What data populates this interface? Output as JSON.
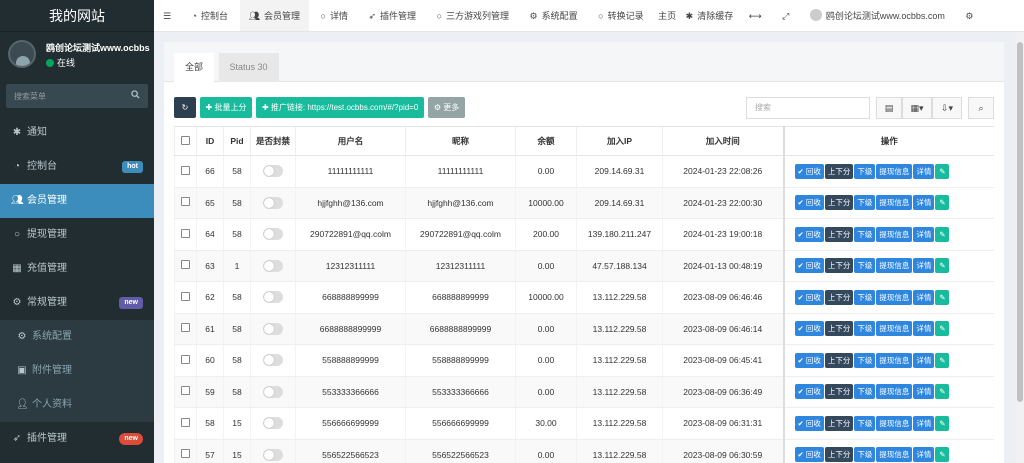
{
  "sidebar": {
    "brand": "我的网站",
    "user": {
      "name": "鸥创论坛测试www.ocbbs",
      "status": "在线"
    },
    "search_placeholder": "搜索菜单",
    "items": [
      {
        "label": "通知",
        "icon": "asterisk-icon"
      },
      {
        "label": "控制台",
        "icon": "dashboard-icon",
        "badge": "hot"
      },
      {
        "label": "会员管理",
        "icon": "users-icon",
        "active": true
      },
      {
        "label": "提现管理",
        "icon": "circle-icon"
      },
      {
        "label": "充值管理",
        "icon": "grid-icon"
      },
      {
        "label": "常规管理",
        "icon": "cogs-icon",
        "badge": "new"
      },
      {
        "label": "系统配置",
        "icon": "cog-icon",
        "sub": true
      },
      {
        "label": "附件管理",
        "icon": "file-image-icon",
        "sub": true
      },
      {
        "label": "个人资料",
        "icon": "user-icon",
        "sub": true
      },
      {
        "label": "插件管理",
        "icon": "rocket-icon",
        "badge": "new"
      }
    ]
  },
  "topbar": {
    "tabs": [
      {
        "label": "控制台",
        "icon": "dashboard-icon"
      },
      {
        "label": "会员管理",
        "icon": "users-icon",
        "active": true
      },
      {
        "label": "详情",
        "icon": "circle-icon"
      },
      {
        "label": "插件管理",
        "icon": "rocket-icon"
      },
      {
        "label": "三方游戏列管理",
        "icon": "circle-icon"
      },
      {
        "label": "系统配置",
        "icon": "cog-icon"
      },
      {
        "label": "转换记录",
        "icon": "circle-icon"
      }
    ],
    "home_label": "主页",
    "clear_cache_label": "清除缓存",
    "user_label": "鸥创论坛测试www.ocbbs.com"
  },
  "content": {
    "tabs": [
      "全部",
      "Status 30"
    ],
    "toolbar": {
      "batch_label": "批量上分",
      "promo_label": "推广链接: https://test.ocbbs.com/#/?pid=0",
      "more_label": "更多",
      "search_placeholder": "搜索"
    },
    "columns": [
      "ID",
      "Pid",
      "是否封禁",
      "用户名",
      "昵称",
      "余额",
      "加入IP",
      "加入时间",
      "操作"
    ],
    "op_buttons": [
      "回收",
      "上下分",
      "下级",
      "提现信息",
      "详情"
    ],
    "rows": [
      {
        "id": "66",
        "pid": "58",
        "username": "11111111111",
        "nickname": "11111111111",
        "balance": "0.00",
        "ip": "209.14.69.31",
        "time": "2024-01-23 22:08:26"
      },
      {
        "id": "65",
        "pid": "58",
        "username": "hjjfghh@136.com",
        "nickname": "hjjfghh@136.com",
        "balance": "10000.00",
        "ip": "209.14.69.31",
        "time": "2024-01-23 22:00:30"
      },
      {
        "id": "64",
        "pid": "58",
        "username": "290722891@qq.colm",
        "nickname": "290722891@qq.colm",
        "balance": "200.00",
        "ip": "139.180.211.247",
        "time": "2024-01-23 19:00:18"
      },
      {
        "id": "63",
        "pid": "1",
        "username": "12312311111",
        "nickname": "12312311111",
        "balance": "0.00",
        "ip": "47.57.188.134",
        "time": "2024-01-13 00:48:19"
      },
      {
        "id": "62",
        "pid": "58",
        "username": "668888899999",
        "nickname": "668888899999",
        "balance": "10000.00",
        "ip": "13.112.229.58",
        "time": "2023-08-09 06:46:46"
      },
      {
        "id": "61",
        "pid": "58",
        "username": "6688888899999",
        "nickname": "6688888899999",
        "balance": "0.00",
        "ip": "13.112.229.58",
        "time": "2023-08-09 06:46:14"
      },
      {
        "id": "60",
        "pid": "58",
        "username": "558888899999",
        "nickname": "558888899999",
        "balance": "0.00",
        "ip": "13.112.229.58",
        "time": "2023-08-09 06:45:41"
      },
      {
        "id": "59",
        "pid": "58",
        "username": "553333366666",
        "nickname": "553333366666",
        "balance": "0.00",
        "ip": "13.112.229.58",
        "time": "2023-08-09 06:36:49"
      },
      {
        "id": "58",
        "pid": "15",
        "username": "556666699999",
        "nickname": "556666699999",
        "balance": "30.00",
        "ip": "13.112.229.58",
        "time": "2023-08-09 06:31:31"
      },
      {
        "id": "57",
        "pid": "15",
        "username": "556522566523",
        "nickname": "556522566523",
        "balance": "0.00",
        "ip": "13.112.229.58",
        "time": "2023-08-09 06:30:59"
      }
    ]
  }
}
